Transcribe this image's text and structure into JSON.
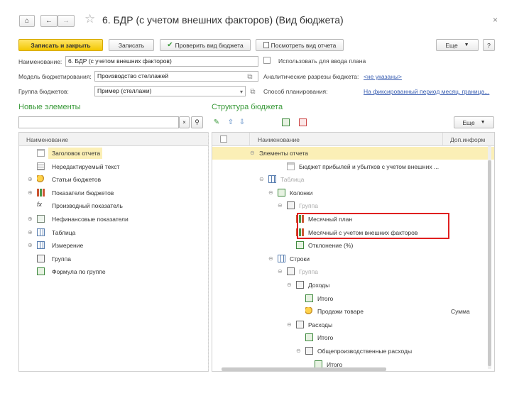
{
  "window": {
    "title": "6. БДР (с учетом внешних факторов) (Вид бюджета)",
    "close_glyph": "×",
    "nav_icons": [
      "home-icon",
      "back-arrow-icon",
      "forward-arrow-icon",
      "star-icon"
    ]
  },
  "toolbar": {
    "save_close": "Записать и закрыть",
    "save": "Записать",
    "check": "Проверить вид бюджета",
    "view_report": "Посмотреть вид отчета",
    "more": "Еще",
    "help": "?"
  },
  "form": {
    "name_label": "Наименование:",
    "name_value": "6. БДР (с учетом внешних факторов)",
    "use_for_plan_label": "Использовать для ввода плана",
    "model_label": "Модель бюджетирования:",
    "model_value": "Производство стеллажей",
    "analytics_label": "Аналитические разрезы бюджета:",
    "analytics_value": "<не указаны>",
    "group_label": "Группа бюджетов:",
    "group_value": "Пример (стеллажи)",
    "planning_label": "Способ планирования:",
    "planning_value": "На фиксированный период месяц, граница..."
  },
  "left_panel": {
    "section_title": "Новые элементы",
    "column_header": "Наименование",
    "items": [
      {
        "label": "Заголовок отчета",
        "icon": "title-icon",
        "expander": "",
        "selected": true
      },
      {
        "label": "Нередактируемый текст",
        "icon": "text-icon",
        "expander": "",
        "selected": false
      },
      {
        "label": "Статьи бюджетов",
        "icon": "coin-icon",
        "expander": "⊕",
        "selected": false
      },
      {
        "label": "Показатели бюджетов",
        "icon": "bars-icon",
        "expander": "⊕",
        "selected": false
      },
      {
        "label": "Производный показатель",
        "icon": "fx-icon",
        "expander": "",
        "selected": false
      },
      {
        "label": "Нефинансовые показатели",
        "icon": "box-icon",
        "expander": "⊕",
        "selected": false
      },
      {
        "label": "Таблица",
        "icon": "table-icon",
        "expander": "⊕",
        "selected": false
      },
      {
        "label": "Измерение",
        "icon": "table-icon",
        "expander": "⊕",
        "selected": false
      },
      {
        "label": "Группа",
        "icon": "plus-icon",
        "expander": "",
        "selected": false
      },
      {
        "label": "Формула по группе",
        "icon": "sigma-icon",
        "expander": "",
        "selected": false
      }
    ]
  },
  "right_panel": {
    "section_title": "Структура бюджета",
    "more": "Еще",
    "col_name": "Наименование",
    "col_extra": "Доп.информ",
    "rows": [
      {
        "label": "Элементы отчета",
        "indent": 0,
        "expander": "⊖",
        "icon": "",
        "grey": false,
        "selected": true,
        "extra": ""
      },
      {
        "label": "Бюджет прибылей и убытков с учетом внешних ...",
        "indent": 3,
        "expander": "",
        "icon": "title-icon",
        "grey": false,
        "selected": false,
        "extra": ""
      },
      {
        "label": "Таблица",
        "indent": 1,
        "expander": "⊖",
        "icon": "table-icon",
        "grey": true,
        "selected": false,
        "extra": ""
      },
      {
        "label": "Колонки",
        "indent": 2,
        "expander": "⊖",
        "icon": "sigma-icon",
        "grey": false,
        "selected": false,
        "extra": ""
      },
      {
        "label": "Группа",
        "indent": 3,
        "expander": "⊖",
        "icon": "plus-icon",
        "grey": true,
        "selected": false,
        "extra": ""
      },
      {
        "label": "Месячный план",
        "indent": 4,
        "expander": "",
        "icon": "bars-icon",
        "grey": false,
        "selected": false,
        "extra": ""
      },
      {
        "label": "Месячный с учетом внешних факторов",
        "indent": 4,
        "expander": "",
        "icon": "bars-icon",
        "grey": false,
        "selected": false,
        "extra": ""
      },
      {
        "label": "Отклонение (%)",
        "indent": 4,
        "expander": "",
        "icon": "sigma-icon",
        "grey": false,
        "selected": false,
        "extra": ""
      },
      {
        "label": "Строки",
        "indent": 2,
        "expander": "⊖",
        "icon": "table-icon",
        "grey": false,
        "selected": false,
        "extra": ""
      },
      {
        "label": "Группа",
        "indent": 3,
        "expander": "⊖",
        "icon": "plus-icon",
        "grey": true,
        "selected": false,
        "extra": ""
      },
      {
        "label": "Доходы",
        "indent": 4,
        "expander": "⊖",
        "icon": "plus-icon",
        "grey": false,
        "selected": false,
        "extra": ""
      },
      {
        "label": "Итого",
        "indent": 5,
        "expander": "",
        "icon": "sigma-icon",
        "grey": false,
        "selected": false,
        "extra": ""
      },
      {
        "label": "Продажи товаре",
        "indent": 5,
        "expander": "",
        "icon": "coin-icon",
        "grey": false,
        "selected": false,
        "extra": "Сумма"
      },
      {
        "label": "Расходы",
        "indent": 4,
        "expander": "⊖",
        "icon": "plus-icon",
        "grey": false,
        "selected": false,
        "extra": ""
      },
      {
        "label": "Итого",
        "indent": 5,
        "expander": "",
        "icon": "sigma-icon",
        "grey": false,
        "selected": false,
        "extra": ""
      },
      {
        "label": "Общепроизводственные расходы",
        "indent": 5,
        "expander": "⊖",
        "icon": "plus-icon",
        "grey": false,
        "selected": false,
        "extra": ""
      },
      {
        "label": "Итого",
        "indent": 6,
        "expander": "",
        "icon": "sigma-icon",
        "grey": false,
        "selected": false,
        "extra": ""
      }
    ]
  },
  "colors": {
    "accent_yellow": "#f3c800",
    "selected_row": "#fbefb6",
    "section_green": "#3a9a3a",
    "highlight_red": "#e02020",
    "link_blue": "#3b5fb2"
  }
}
